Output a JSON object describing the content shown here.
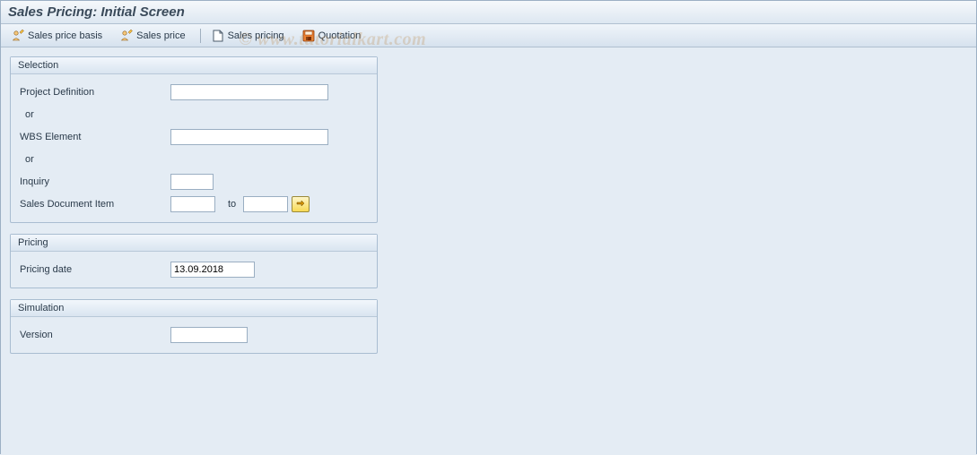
{
  "title": "Sales Pricing: Initial Screen",
  "toolbar": {
    "sales_price_basis": "Sales price basis",
    "sales_price": "Sales price",
    "sales_pricing": "Sales pricing",
    "quotation": "Quotation"
  },
  "groups": {
    "selection": {
      "title": "Selection",
      "project_definition": {
        "label": "Project Definition",
        "value": ""
      },
      "or1": "or",
      "wbs_element": {
        "label": "WBS Element",
        "value": ""
      },
      "or2": "or",
      "inquiry": {
        "label": "Inquiry",
        "value": ""
      },
      "sales_doc_item": {
        "label": "Sales Document Item",
        "from": "",
        "to_label": "to",
        "to": ""
      }
    },
    "pricing": {
      "title": "Pricing",
      "pricing_date": {
        "label": "Pricing date",
        "value": "13.09.2018"
      }
    },
    "simulation": {
      "title": "Simulation",
      "version": {
        "label": "Version",
        "value": ""
      }
    }
  },
  "watermark": "© www.tutorialkart.com"
}
